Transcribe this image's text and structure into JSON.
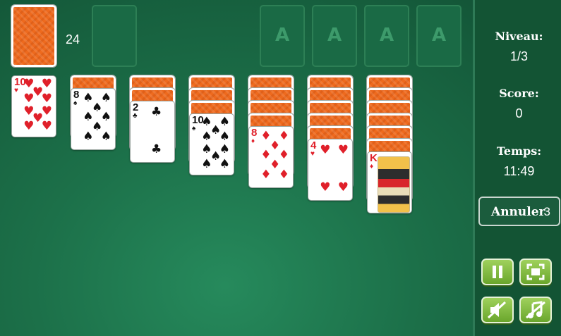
{
  "stock": {
    "count": "24"
  },
  "foundations": [
    {
      "label": "A"
    },
    {
      "label": "A"
    },
    {
      "label": "A"
    },
    {
      "label": "A"
    }
  ],
  "tableau": [
    {
      "hidden": 0,
      "face": {
        "rank": "10",
        "suit": "♥",
        "color": "red"
      }
    },
    {
      "hidden": 1,
      "face": {
        "rank": "8",
        "suit": "♠",
        "color": "black"
      }
    },
    {
      "hidden": 2,
      "face": {
        "rank": "2",
        "suit": "♣",
        "color": "black"
      }
    },
    {
      "hidden": 3,
      "face": {
        "rank": "10",
        "suit": "♠",
        "color": "black"
      }
    },
    {
      "hidden": 4,
      "face": {
        "rank": "8",
        "suit": "♦",
        "color": "red"
      }
    },
    {
      "hidden": 5,
      "face": {
        "rank": "4",
        "suit": "♥",
        "color": "red"
      }
    },
    {
      "hidden": 6,
      "face": {
        "rank": "K",
        "suit": "♦",
        "color": "red"
      }
    }
  ],
  "sidebar": {
    "level_label": "Niveau:",
    "level_value": "1/3",
    "score_label": "Score:",
    "score_value": "0",
    "time_label": "Temps:",
    "time_value": "11:49",
    "undo_label": "Annuler",
    "undo_count": "3"
  },
  "controls": {
    "icons": [
      "pause-icon",
      "fullscreen-icon",
      "sound-off-icon",
      "music-off-icon"
    ]
  },
  "colors": {
    "table": "#1c7049",
    "card_back": "#ee6a1e",
    "button": "#8cc34a"
  }
}
